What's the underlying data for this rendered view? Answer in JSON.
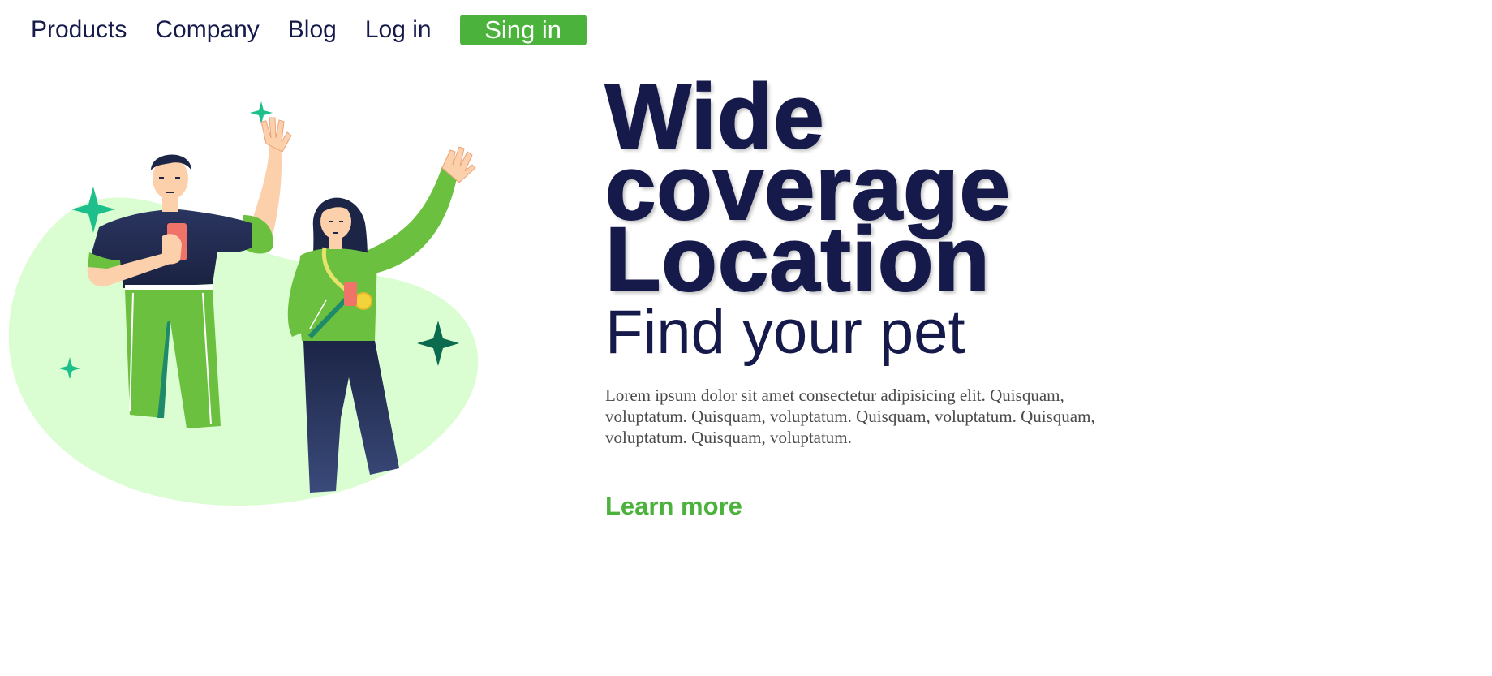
{
  "nav": {
    "items": [
      {
        "label": "Products"
      },
      {
        "label": "Company"
      },
      {
        "label": "Blog"
      },
      {
        "label": "Log in"
      }
    ],
    "signin_label": "Sing in"
  },
  "hero": {
    "headline_lines": [
      "Wide",
      "coverage",
      "Location"
    ],
    "subheadline": "Find your pet",
    "body": "Lorem ipsum dolor sit amet consectetur adipisicing elit. Quisquam, voluptatum. Quisquam, voluptatum. Quisquam, voluptatum. Quisquam, voluptatum. Quisquam, voluptatum.",
    "cta_label": "Learn more"
  },
  "illustration": {
    "icon": "two-people-waving-illustration"
  },
  "colors": {
    "accent_green": "#4bb33b",
    "navy": "#161a4a",
    "blob": "#dbfdd2",
    "sparkle": "#1dbf8a",
    "sparkle_dark": "#0b6b4e"
  }
}
